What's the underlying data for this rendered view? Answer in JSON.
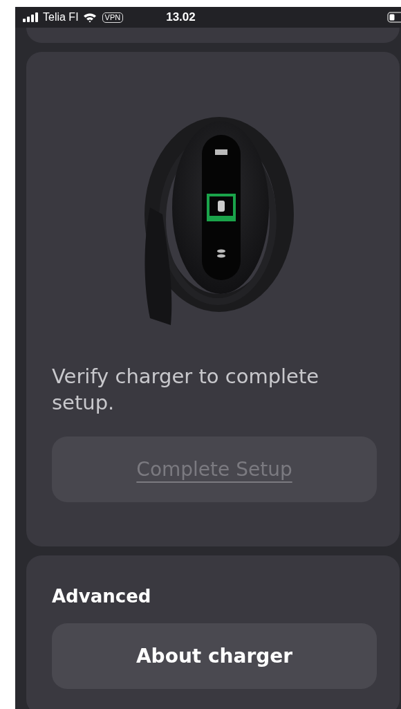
{
  "status_bar": {
    "carrier": "Telia FI",
    "vpn": "VPN",
    "time": "13.02"
  },
  "setup_card": {
    "message": "Verify charger to complete setup.",
    "button": {
      "label": "Complete Setup",
      "disabled": true
    }
  },
  "advanced_card": {
    "title": "Advanced",
    "buttons": [
      {
        "label": "About charger",
        "disabled": false
      }
    ]
  }
}
